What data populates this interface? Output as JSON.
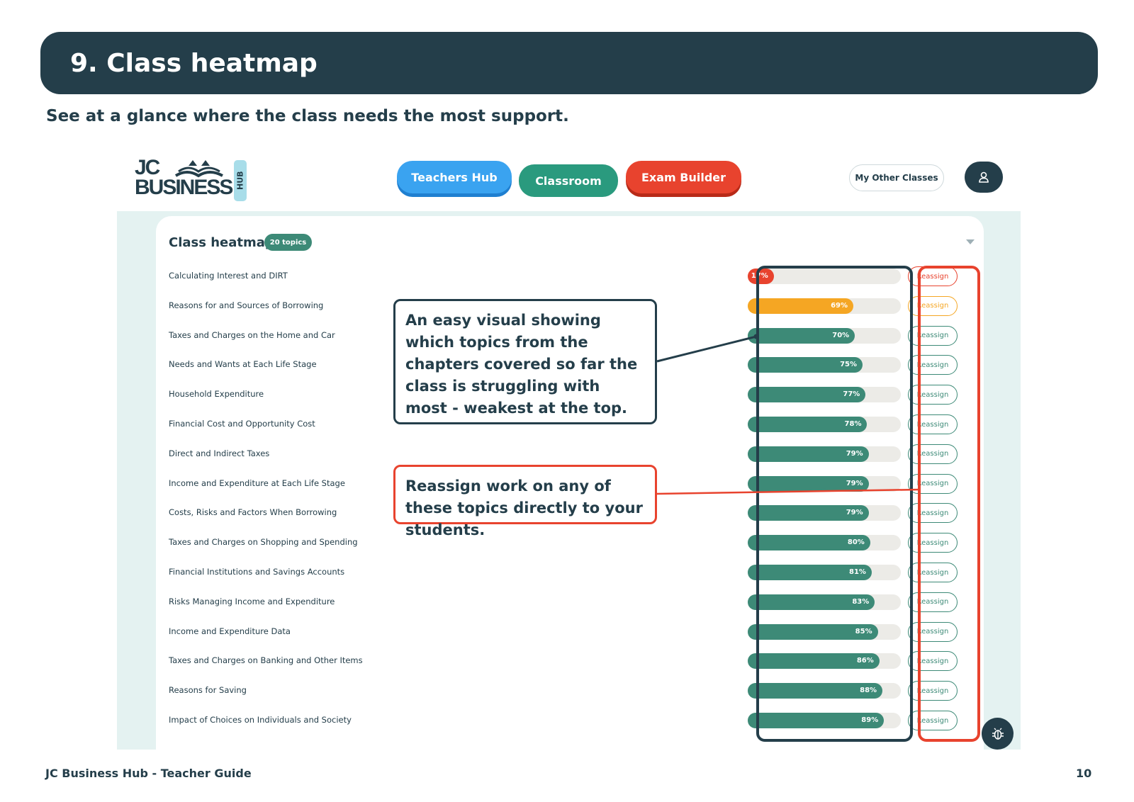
{
  "section": {
    "title": "9. Class heatmap",
    "subtitle": "See at a glance where the class needs the most support."
  },
  "app": {
    "logo": {
      "line1": "JC",
      "line2": "BUSINESS",
      "tag": "HUB"
    },
    "nav": {
      "teachers_hub": "Teachers Hub",
      "classroom": "Classroom",
      "exam_builder": "Exam Builder",
      "my_other_classes": "My Other Classes"
    },
    "heatmap": {
      "title": "Class heatmap",
      "badge": "20 topics",
      "reassign_label": "Reassign",
      "colors": {
        "low": "#e8432e",
        "mid": "#f5a623",
        "good": "#3d8a77"
      },
      "rows": [
        {
          "topic": "Calculating Interest and DIRT",
          "percent": 17,
          "label": "17%",
          "level": "low"
        },
        {
          "topic": "Reasons for and Sources of Borrowing",
          "percent": 69,
          "label": "69%",
          "level": "mid"
        },
        {
          "topic": "Taxes and Charges on the Home and Car",
          "percent": 70,
          "label": "70%",
          "level": "good"
        },
        {
          "topic": "Needs and Wants at Each Life Stage",
          "percent": 75,
          "label": "75%",
          "level": "good"
        },
        {
          "topic": "Household Expenditure",
          "percent": 77,
          "label": "77%",
          "level": "good"
        },
        {
          "topic": "Financial Cost and Opportunity Cost",
          "percent": 78,
          "label": "78%",
          "level": "good"
        },
        {
          "topic": "Direct and Indirect Taxes",
          "percent": 79,
          "label": "79%",
          "level": "good"
        },
        {
          "topic": "Income and Expenditure at Each Life Stage",
          "percent": 79,
          "label": "79%",
          "level": "good"
        },
        {
          "topic": "Costs, Risks and Factors When Borrowing",
          "percent": 79,
          "label": "79%",
          "level": "good"
        },
        {
          "topic": "Taxes and Charges on Shopping and Spending",
          "percent": 80,
          "label": "80%",
          "level": "good"
        },
        {
          "topic": "Financial Institutions and Savings Accounts",
          "percent": 81,
          "label": "81%",
          "level": "good"
        },
        {
          "topic": "Risks Managing Income and Expenditure",
          "percent": 83,
          "label": "83%",
          "level": "good"
        },
        {
          "topic": "Income and Expenditure Data",
          "percent": 85,
          "label": "85%",
          "level": "good"
        },
        {
          "topic": "Taxes and Charges on Banking and Other Items",
          "percent": 86,
          "label": "86%",
          "level": "good"
        },
        {
          "topic": "Reasons for Saving",
          "percent": 88,
          "label": "88%",
          "level": "good"
        },
        {
          "topic": "Impact of Choices on Individuals and Society",
          "percent": 89,
          "label": "89%",
          "level": "good"
        }
      ]
    }
  },
  "callouts": {
    "visual": "An easy visual showing which topics from the chapters covered so far the class is struggling with most - weakest at the top.",
    "reassign": "Reassign work on any of these topics directly to your students."
  },
  "footer": {
    "left": "JC Business Hub - Teacher Guide",
    "page": "10"
  }
}
